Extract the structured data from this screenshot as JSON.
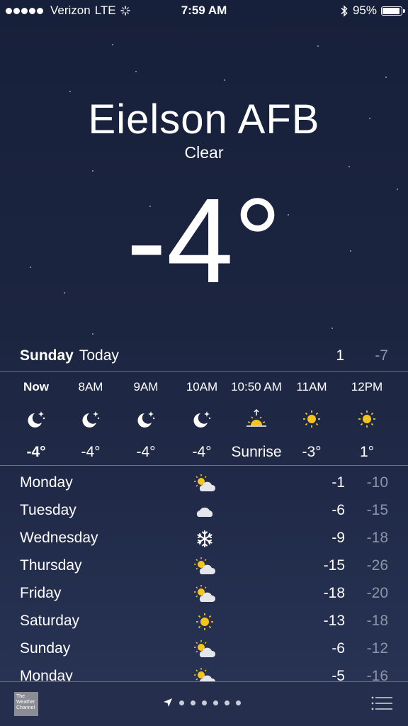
{
  "status_bar": {
    "carrier": "Verizon",
    "network": "LTE",
    "time": "7:59 AM",
    "battery": "95%"
  },
  "current": {
    "city": "Eielson AFB",
    "condition": "Clear",
    "temperature": "-4°"
  },
  "today": {
    "day": "Sunday",
    "label": "Today",
    "high": "1",
    "low": "-7"
  },
  "hourly": [
    {
      "time": "Now",
      "icon": "moon-stars-icon",
      "value": "-4°"
    },
    {
      "time": "8AM",
      "icon": "moon-stars-icon",
      "value": "-4°"
    },
    {
      "time": "9AM",
      "icon": "moon-stars-icon",
      "value": "-4°"
    },
    {
      "time": "10AM",
      "icon": "moon-stars-icon",
      "value": "-4°"
    },
    {
      "time": "10:50 AM",
      "icon": "sunrise-icon",
      "value": "Sunrise"
    },
    {
      "time": "11AM",
      "icon": "sun-icon",
      "value": "-3°"
    },
    {
      "time": "12PM",
      "icon": "sun-icon",
      "value": "1°"
    }
  ],
  "daily": [
    {
      "day": "Monday",
      "icon": "partly-cloudy-icon",
      "high": "-1",
      "low": "-10"
    },
    {
      "day": "Tuesday",
      "icon": "cloud-icon",
      "high": "-6",
      "low": "-15"
    },
    {
      "day": "Wednesday",
      "icon": "snowflake-icon",
      "high": "-9",
      "low": "-18"
    },
    {
      "day": "Thursday",
      "icon": "partly-cloudy-icon",
      "high": "-15",
      "low": "-26"
    },
    {
      "day": "Friday",
      "icon": "partly-cloudy-icon",
      "high": "-18",
      "low": "-20"
    },
    {
      "day": "Saturday",
      "icon": "sun-icon",
      "high": "-13",
      "low": "-18"
    },
    {
      "day": "Sunday",
      "icon": "partly-cloudy-icon",
      "high": "-6",
      "low": "-12"
    },
    {
      "day": "Monday",
      "icon": "partly-cloudy-icon",
      "high": "-5",
      "low": "-16"
    }
  ],
  "bottom_bar": {
    "logo_text": "The Weather Channel",
    "page_dots": 6
  },
  "colors": {
    "sun": "#f6c51d",
    "low_temp": "#8d94a8",
    "background": "#1c2540"
  }
}
